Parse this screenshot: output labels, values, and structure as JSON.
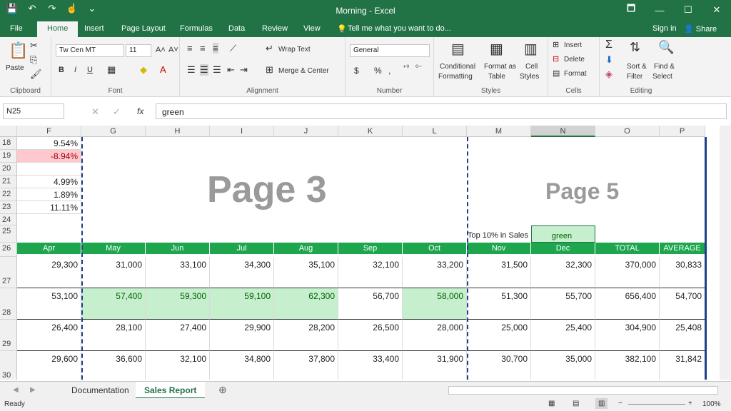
{
  "title": "Morning - Excel",
  "qat": {
    "save": "💾",
    "undo": "↶",
    "redo": "↷",
    "touch": "☝",
    "more": "⌄"
  },
  "win": {
    "restore": "🗖",
    "min": "—",
    "max": "☐",
    "close": "✕"
  },
  "tabs": [
    "File",
    "Home",
    "Insert",
    "Page Layout",
    "Formulas",
    "Data",
    "Review",
    "View"
  ],
  "tell": "Tell me what you want to do...",
  "signin": "Sign in",
  "share": "Share",
  "ribbon": {
    "clipboard": {
      "paste": "Paste",
      "group": "Clipboard"
    },
    "font": {
      "name": "Tw Cen MT",
      "size": "11",
      "bold": "B",
      "italic": "I",
      "underline": "U",
      "grow": "A˄",
      "shrink": "A˅",
      "group": "Font"
    },
    "alignment": {
      "wrap": "Wrap Text",
      "merge": "Merge & Center",
      "group": "Alignment"
    },
    "number": {
      "format": "General",
      "currency": "$",
      "percent": "%",
      "comma": ",",
      "group": "Number"
    },
    "styles": {
      "cf1": "Conditional",
      "cf2": "Formatting",
      "fat1": "Format as",
      "fat2": "Table",
      "cs1": "Cell",
      "cs2": "Styles",
      "group": "Styles"
    },
    "cells": {
      "insert": "Insert",
      "delete": "Delete",
      "format": "Format",
      "group": "Cells"
    },
    "editing": {
      "sort1": "Sort &",
      "sort2": "Filter",
      "find1": "Find &",
      "find2": "Select",
      "group": "Editing"
    }
  },
  "namebox": "N25",
  "fx": "fx",
  "formula": "green",
  "cols": [
    "F",
    "G",
    "H",
    "I",
    "J",
    "K",
    "L",
    "M",
    "N",
    "O",
    "P"
  ],
  "rows": [
    "18",
    "19",
    "20",
    "21",
    "22",
    "23",
    "24",
    "25",
    "26",
    "27",
    "28",
    "29",
    "30"
  ],
  "fvals": [
    "9.54%",
    "-8.94%",
    "",
    "4.99%",
    "1.89%",
    "11.11%"
  ],
  "pages": {
    "p3": "Page 3",
    "p5": "Page 5"
  },
  "top10": "Top 10% in Sales",
  "n25": "green",
  "headers": [
    "Apr",
    "May",
    "Jun",
    "Jul",
    "Aug",
    "Sep",
    "Oct",
    "Nov",
    "Dec",
    "TOTAL",
    "AVERAGE"
  ],
  "data": [
    [
      "29,300",
      "31,000",
      "33,100",
      "34,300",
      "35,100",
      "32,100",
      "33,200",
      "31,500",
      "32,300",
      "370,000",
      "30,833"
    ],
    [
      "53,100",
      "57,400",
      "59,300",
      "59,100",
      "62,300",
      "56,700",
      "58,000",
      "51,300",
      "55,700",
      "656,400",
      "54,700"
    ],
    [
      "26,400",
      "28,100",
      "27,400",
      "29,900",
      "28,200",
      "26,500",
      "28,000",
      "25,000",
      "25,400",
      "304,900",
      "25,408"
    ],
    [
      "29,600",
      "36,600",
      "32,100",
      "34,800",
      "37,800",
      "33,400",
      "31,900",
      "30,700",
      "35,000",
      "382,100",
      "31,842"
    ]
  ],
  "sheets": [
    "Documentation",
    "Sales Report"
  ],
  "status": "Ready",
  "zoom": "100%"
}
